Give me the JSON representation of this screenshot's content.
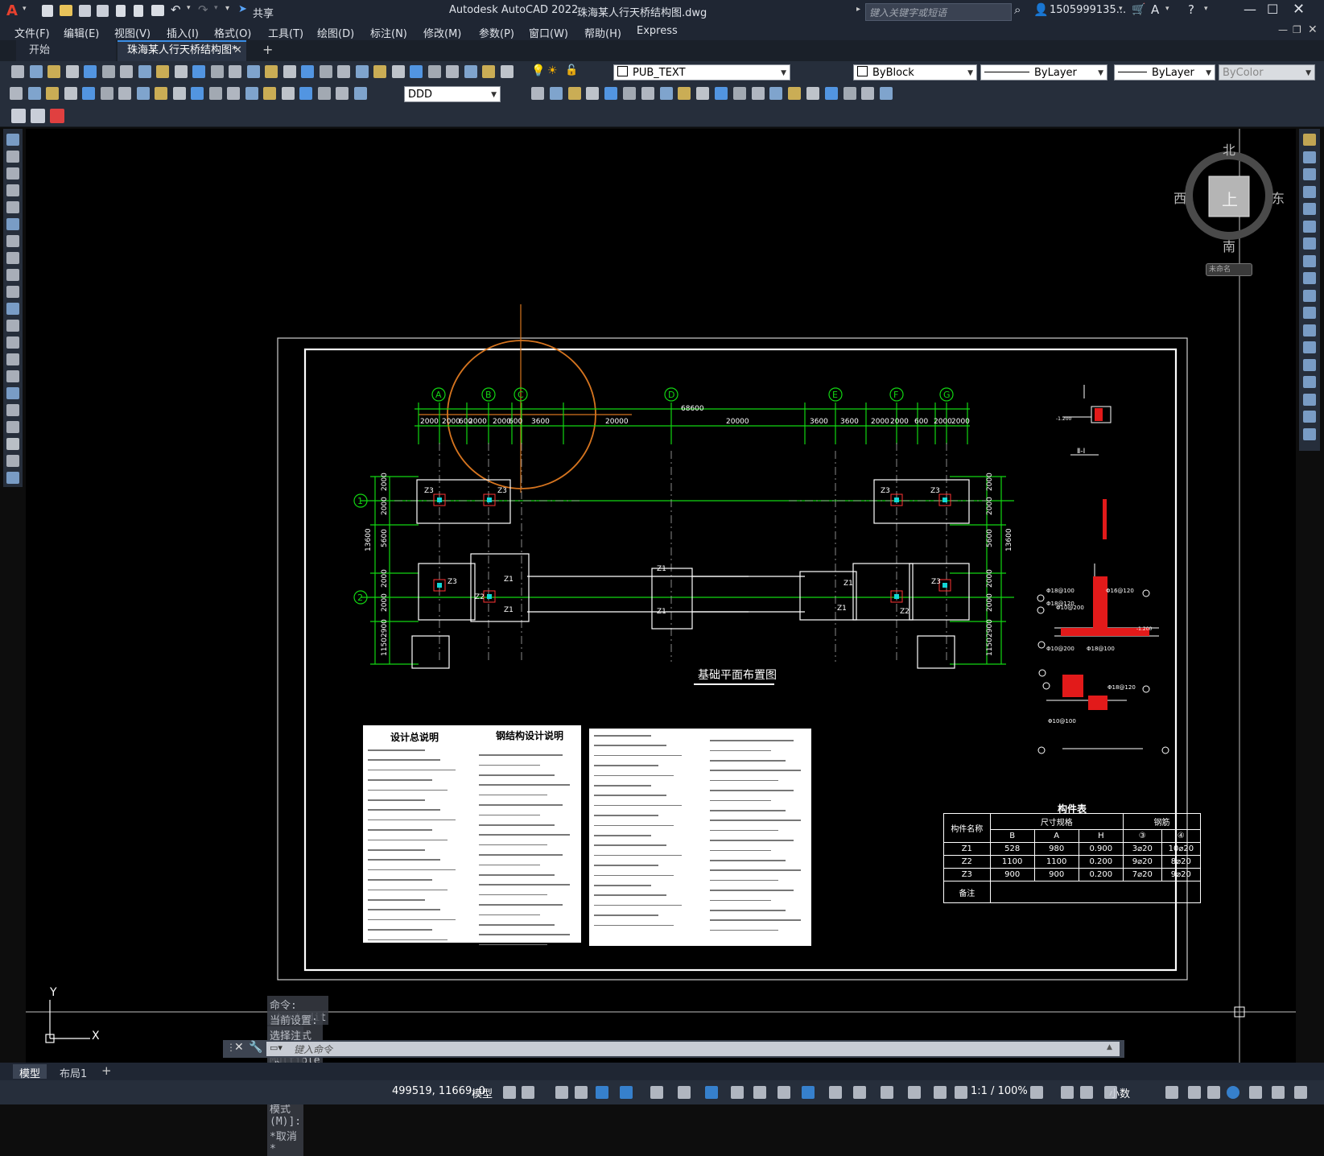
{
  "app": {
    "logo": "A",
    "title": "Autodesk AutoCAD 2022",
    "filename": "珠海某人行天桥结构图.dwg",
    "search_placeholder": "键入关键字或短语",
    "user": "1505999135...",
    "share": "共享"
  },
  "menu": [
    "文件(F)",
    "编辑(E)",
    "视图(V)",
    "插入(I)",
    "格式(O)",
    "工具(T)",
    "绘图(D)",
    "标注(N)",
    "修改(M)",
    "参数(P)",
    "窗口(W)",
    "帮助(H)",
    "Express"
  ],
  "tabs": {
    "start": "开始",
    "file": "珠海某人行天桥结构图*"
  },
  "toolbar": {
    "layer": "PUB_TEXT",
    "color": "ByBlock",
    "linetype": "ByLayer",
    "lineweight": "ByLayer",
    "plotstyle": "ByColor",
    "dimstyle": "DDD"
  },
  "viewcube": {
    "north": "北",
    "south": "南",
    "east": "东",
    "west": "西",
    "top": "上",
    "ucs": "未命名"
  },
  "drawing": {
    "grid_letters": [
      "A",
      "B",
      "C",
      "D",
      "E",
      "F",
      "G"
    ],
    "grid_numbers": [
      "1",
      "2"
    ],
    "total_dim": "68600",
    "top_dims_left": [
      "2000",
      "2000",
      "600",
      "2000",
      "2000",
      "600",
      "3600"
    ],
    "top_dims_mid": [
      "20000",
      "20000"
    ],
    "top_dims_right": [
      "3600",
      "3600",
      "2000",
      "2000",
      "600",
      "2000",
      "2000"
    ],
    "left_dims": [
      "2000",
      "2000",
      "13600",
      "5600",
      "2000",
      "2000",
      "2900",
      "1150"
    ],
    "right_dims": [
      "2000",
      "2000",
      "13600",
      "5600",
      "2000",
      "2000",
      "2900",
      "1150"
    ],
    "plan_title": "基础平面布置图",
    "section_label": "Ⅱ-Ⅰ",
    "labels": {
      "z1": "Z1",
      "z2": "Z2",
      "z3": "Z3"
    },
    "rebar": [
      "Φ18@100",
      "Φ18@120",
      "Φ10@200",
      "Φ16@120",
      "Φ18@120",
      "Φ10@100",
      "Φ10@200",
      "Φ18@100"
    ],
    "elev": [
      "-1.200",
      "-1.200"
    ]
  },
  "notes": {
    "title1": "设计总说明",
    "title2": "钢结构设计说明"
  },
  "component_table": {
    "title": "构件表",
    "headers": [
      "构件名称",
      "尺寸规格",
      "钢筋"
    ],
    "subheaders": [
      "B",
      "A",
      "H",
      "③",
      "④"
    ],
    "rows": [
      [
        "Z1",
        "528",
        "980",
        "0.900",
        "3⌀20",
        "10⌀20"
      ],
      [
        "Z2",
        "1100",
        "1100",
        "0.200",
        "9⌀20",
        "8⌀20"
      ],
      [
        "Z3",
        "900",
        "900",
        "0.200",
        "7⌀20",
        "9⌀20"
      ]
    ],
    "remark": "备注"
  },
  "command": {
    "history": [
      "命令: _textedit",
      "当前设置: 编辑模式 = Multiple",
      "选择注释对象或 [放弃(U)/模式(M)]: *取消*"
    ],
    "placeholder": "键入命令"
  },
  "layout_tabs": [
    "模型",
    "布局1"
  ],
  "status": {
    "coords": "499519, 11669, 0",
    "model": "模型",
    "scale": "1:1 / 100%",
    "units": "小数"
  },
  "ucs": {
    "x": "X",
    "y": "Y"
  }
}
